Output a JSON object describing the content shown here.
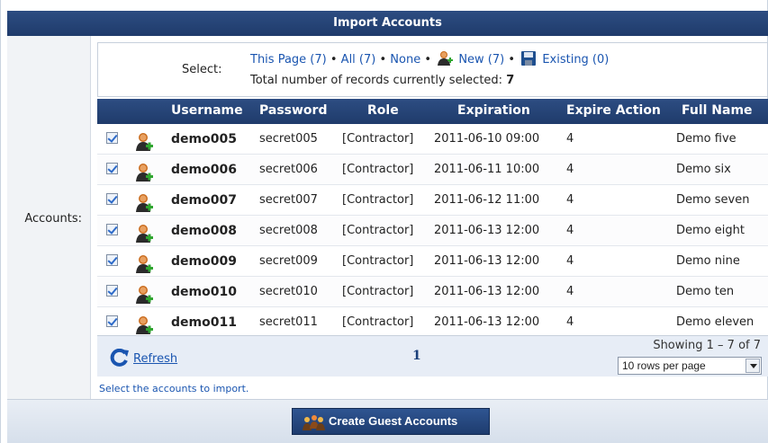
{
  "header": {
    "title": "Import Accounts"
  },
  "form": {
    "accounts_label": "Accounts:",
    "hint": "Select the accounts to import."
  },
  "select": {
    "label": "Select:",
    "this_page": "This Page (7)",
    "all": "All (7)",
    "none": "None",
    "new": "New (7)",
    "existing": "Existing (0)",
    "separator": "•",
    "total_text": "Total number of records currently selected:",
    "total_count": "7"
  },
  "columns": [
    "Username",
    "Password",
    "Role",
    "Expiration",
    "Expire Action",
    "Full Name"
  ],
  "rows": [
    {
      "checked": true,
      "icon": "user-new-icon",
      "username": "demo005",
      "password": "secret005",
      "role": "[Contractor]",
      "expiration": "2011-06-10 09:00",
      "expire_action": "4",
      "full_name": "Demo five"
    },
    {
      "checked": true,
      "icon": "user-new-icon",
      "username": "demo006",
      "password": "secret006",
      "role": "[Contractor]",
      "expiration": "2011-06-11 10:00",
      "expire_action": "4",
      "full_name": "Demo six"
    },
    {
      "checked": true,
      "icon": "user-new-icon",
      "username": "demo007",
      "password": "secret007",
      "role": "[Contractor]",
      "expiration": "2011-06-12 11:00",
      "expire_action": "4",
      "full_name": "Demo seven"
    },
    {
      "checked": true,
      "icon": "user-new-icon",
      "username": "demo008",
      "password": "secret008",
      "role": "[Contractor]",
      "expiration": "2011-06-13 12:00",
      "expire_action": "4",
      "full_name": "Demo eight"
    },
    {
      "checked": true,
      "icon": "user-new-icon",
      "username": "demo009",
      "password": "secret009",
      "role": "[Contractor]",
      "expiration": "2011-06-13 12:00",
      "expire_action": "4",
      "full_name": "Demo nine"
    },
    {
      "checked": true,
      "icon": "user-new-icon",
      "username": "demo010",
      "password": "secret010",
      "role": "[Contractor]",
      "expiration": "2011-06-13 12:00",
      "expire_action": "4",
      "full_name": "Demo ten"
    },
    {
      "checked": true,
      "icon": "user-new-icon",
      "username": "demo011",
      "password": "secret011",
      "role": "[Contractor]",
      "expiration": "2011-06-13 12:00",
      "expire_action": "4",
      "full_name": "Demo eleven"
    }
  ],
  "footer": {
    "refresh": "Refresh",
    "page": "1",
    "showing": "Showing 1 – 7 of 7",
    "rows_per_page": "10 rows per page"
  },
  "actions": {
    "create": "Create Guest Accounts"
  },
  "colors": {
    "header_bg": "#1f3b6b",
    "link": "#1a55b0",
    "footer_bg": "#e7edf6"
  }
}
